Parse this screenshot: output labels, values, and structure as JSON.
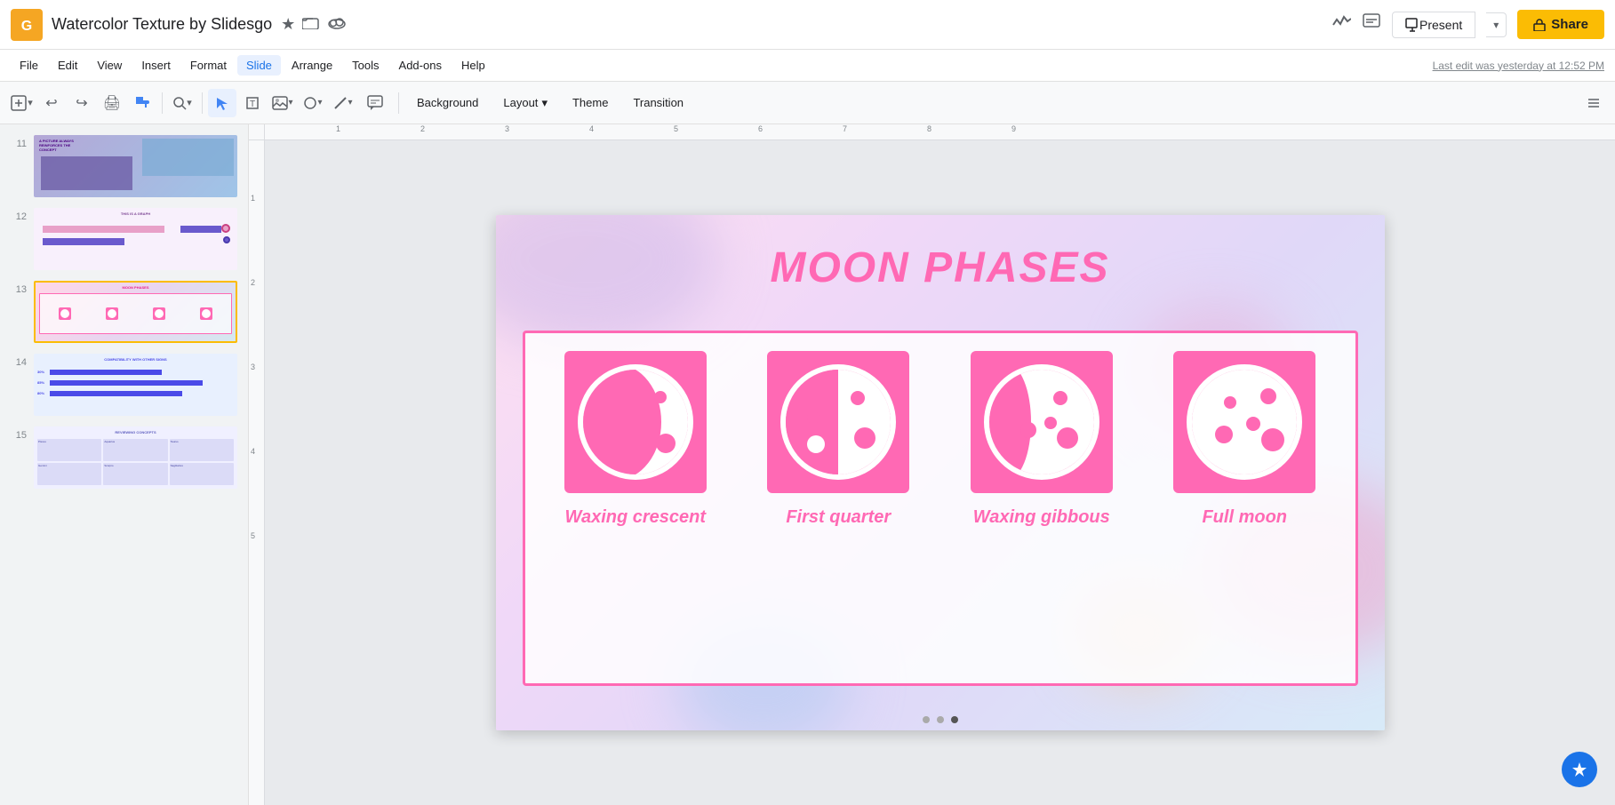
{
  "app": {
    "logo": "G",
    "title": "Watercolor Texture by Slidesgo",
    "last_edit": "Last edit was yesterday at 12:52 PM"
  },
  "titlebar": {
    "star_icon": "★",
    "folder_icon": "⊡",
    "cloud_icon": "☁"
  },
  "topbar_right": {
    "present_label": "Present",
    "share_label": "🔒 Share",
    "dropdown_arrow": "▾"
  },
  "menubar": {
    "items": [
      "File",
      "Edit",
      "View",
      "Insert",
      "Format",
      "Slide",
      "Arrange",
      "Tools",
      "Add-ons",
      "Help"
    ]
  },
  "toolbar": {
    "background_label": "Background",
    "layout_label": "Layout",
    "theme_label": "Theme",
    "transition_label": "Transition"
  },
  "slides": [
    {
      "num": "11",
      "active": false
    },
    {
      "num": "12",
      "active": false
    },
    {
      "num": "13",
      "active": true
    },
    {
      "num": "14",
      "active": false
    },
    {
      "num": "15",
      "active": false
    }
  ],
  "slide": {
    "title": "MOON PHASES",
    "phases": [
      {
        "label": "Waxing crescent",
        "type": "crescent"
      },
      {
        "label": "First quarter",
        "type": "quarter"
      },
      {
        "label": "Waxing gibbous",
        "type": "gibbous"
      },
      {
        "label": "Full moon",
        "type": "full"
      }
    ]
  },
  "ruler": {
    "marks_h": [
      "1",
      "2",
      "3",
      "4",
      "5",
      "6",
      "7",
      "8",
      "9"
    ],
    "marks_v": [
      "1",
      "2",
      "3",
      "4",
      "5"
    ]
  },
  "colors": {
    "accent_pink": "#ff69b4",
    "accent_yellow": "#fbbc04",
    "selected_border": "#fbbc04"
  }
}
